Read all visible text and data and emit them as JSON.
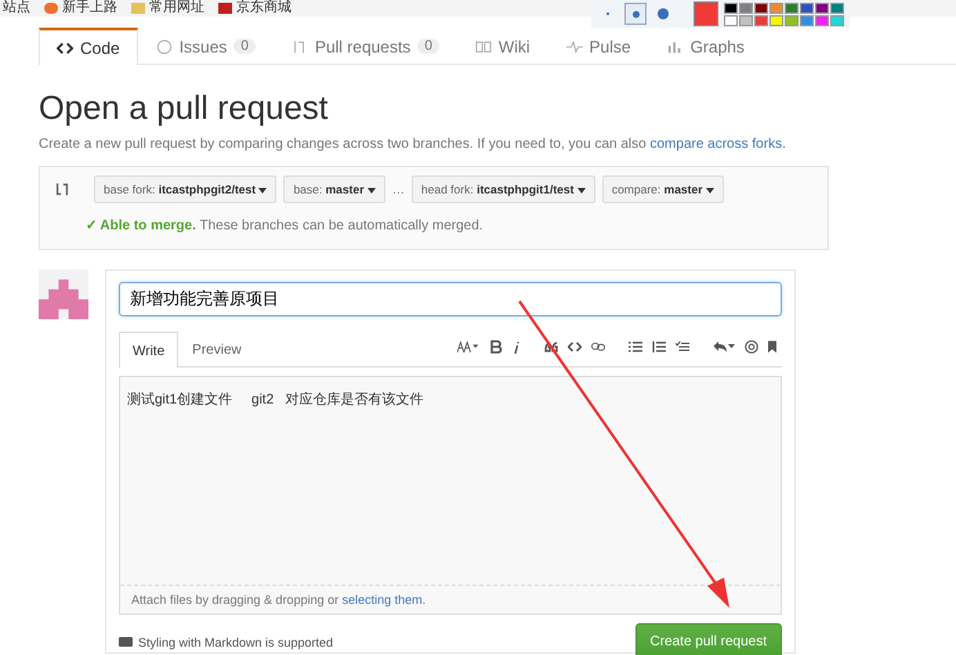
{
  "bookmarks": [
    "站点",
    "新手上路",
    "常用网址",
    "京东商城"
  ],
  "drawing_toolbar": {
    "pen_sizes": [
      {
        "selected": false
      },
      {
        "selected": true
      },
      {
        "selected": false
      }
    ],
    "palette": [
      {
        "color": "#000000"
      },
      {
        "color": "#808080"
      },
      {
        "color": "#800000"
      },
      {
        "color": "#f08a30"
      },
      {
        "color": "#2e7d32"
      },
      {
        "color": "#3050c0"
      },
      {
        "color": "#800080"
      },
      {
        "color": "#008080"
      },
      {
        "color": "#ffffff"
      },
      {
        "color": "#c0c0c0"
      },
      {
        "color": "#f03a3a"
      },
      {
        "color": "#f5f500"
      },
      {
        "color": "#90c020"
      },
      {
        "color": "#3090e0"
      },
      {
        "color": "#f020f0"
      },
      {
        "color": "#20d8d8"
      }
    ]
  },
  "repo_tabs": [
    {
      "label": "Code",
      "kind": "code",
      "selected": true
    },
    {
      "label": "Issues",
      "count": "0",
      "kind": "issues",
      "selected": false
    },
    {
      "label": "Pull requests",
      "count": "0",
      "kind": "pr",
      "selected": false
    },
    {
      "label": "Wiki",
      "kind": "wiki",
      "selected": false
    },
    {
      "label": "Pulse",
      "kind": "pulse",
      "selected": false
    },
    {
      "label": "Graphs",
      "kind": "graphs",
      "selected": false
    }
  ],
  "title": "Open a pull request",
  "description": "Create a new pull request by comparing changes across two branches. If you need to, you can also ",
  "description_link": "compare across forks.",
  "compare": {
    "selectors": [
      {
        "prefix": "base fork:",
        "value": "itcastphpgit2/test"
      },
      {
        "prefix": "base:",
        "value": "master"
      },
      {
        "prefix": "head fork:",
        "value": "itcastphpgit1/test"
      },
      {
        "prefix": "compare:",
        "value": "master"
      }
    ],
    "ellipsis": "…",
    "merge_status": "✓ Able to merge.",
    "merge_note": "These branches can be automatically merged."
  },
  "form": {
    "title_value": "新增功能完善原项目",
    "editor_tabs": [
      {
        "label": "Write",
        "selected": true
      },
      {
        "label": "Preview",
        "selected": false
      }
    ],
    "body_value": "测试git1创建文件     git2   对应仓库是否有该文件",
    "attach_text": "Attach files by dragging & dropping or ",
    "attach_link": "selecting them.",
    "markdown_note": "Styling with Markdown is supported",
    "submit": "Create pull request"
  }
}
